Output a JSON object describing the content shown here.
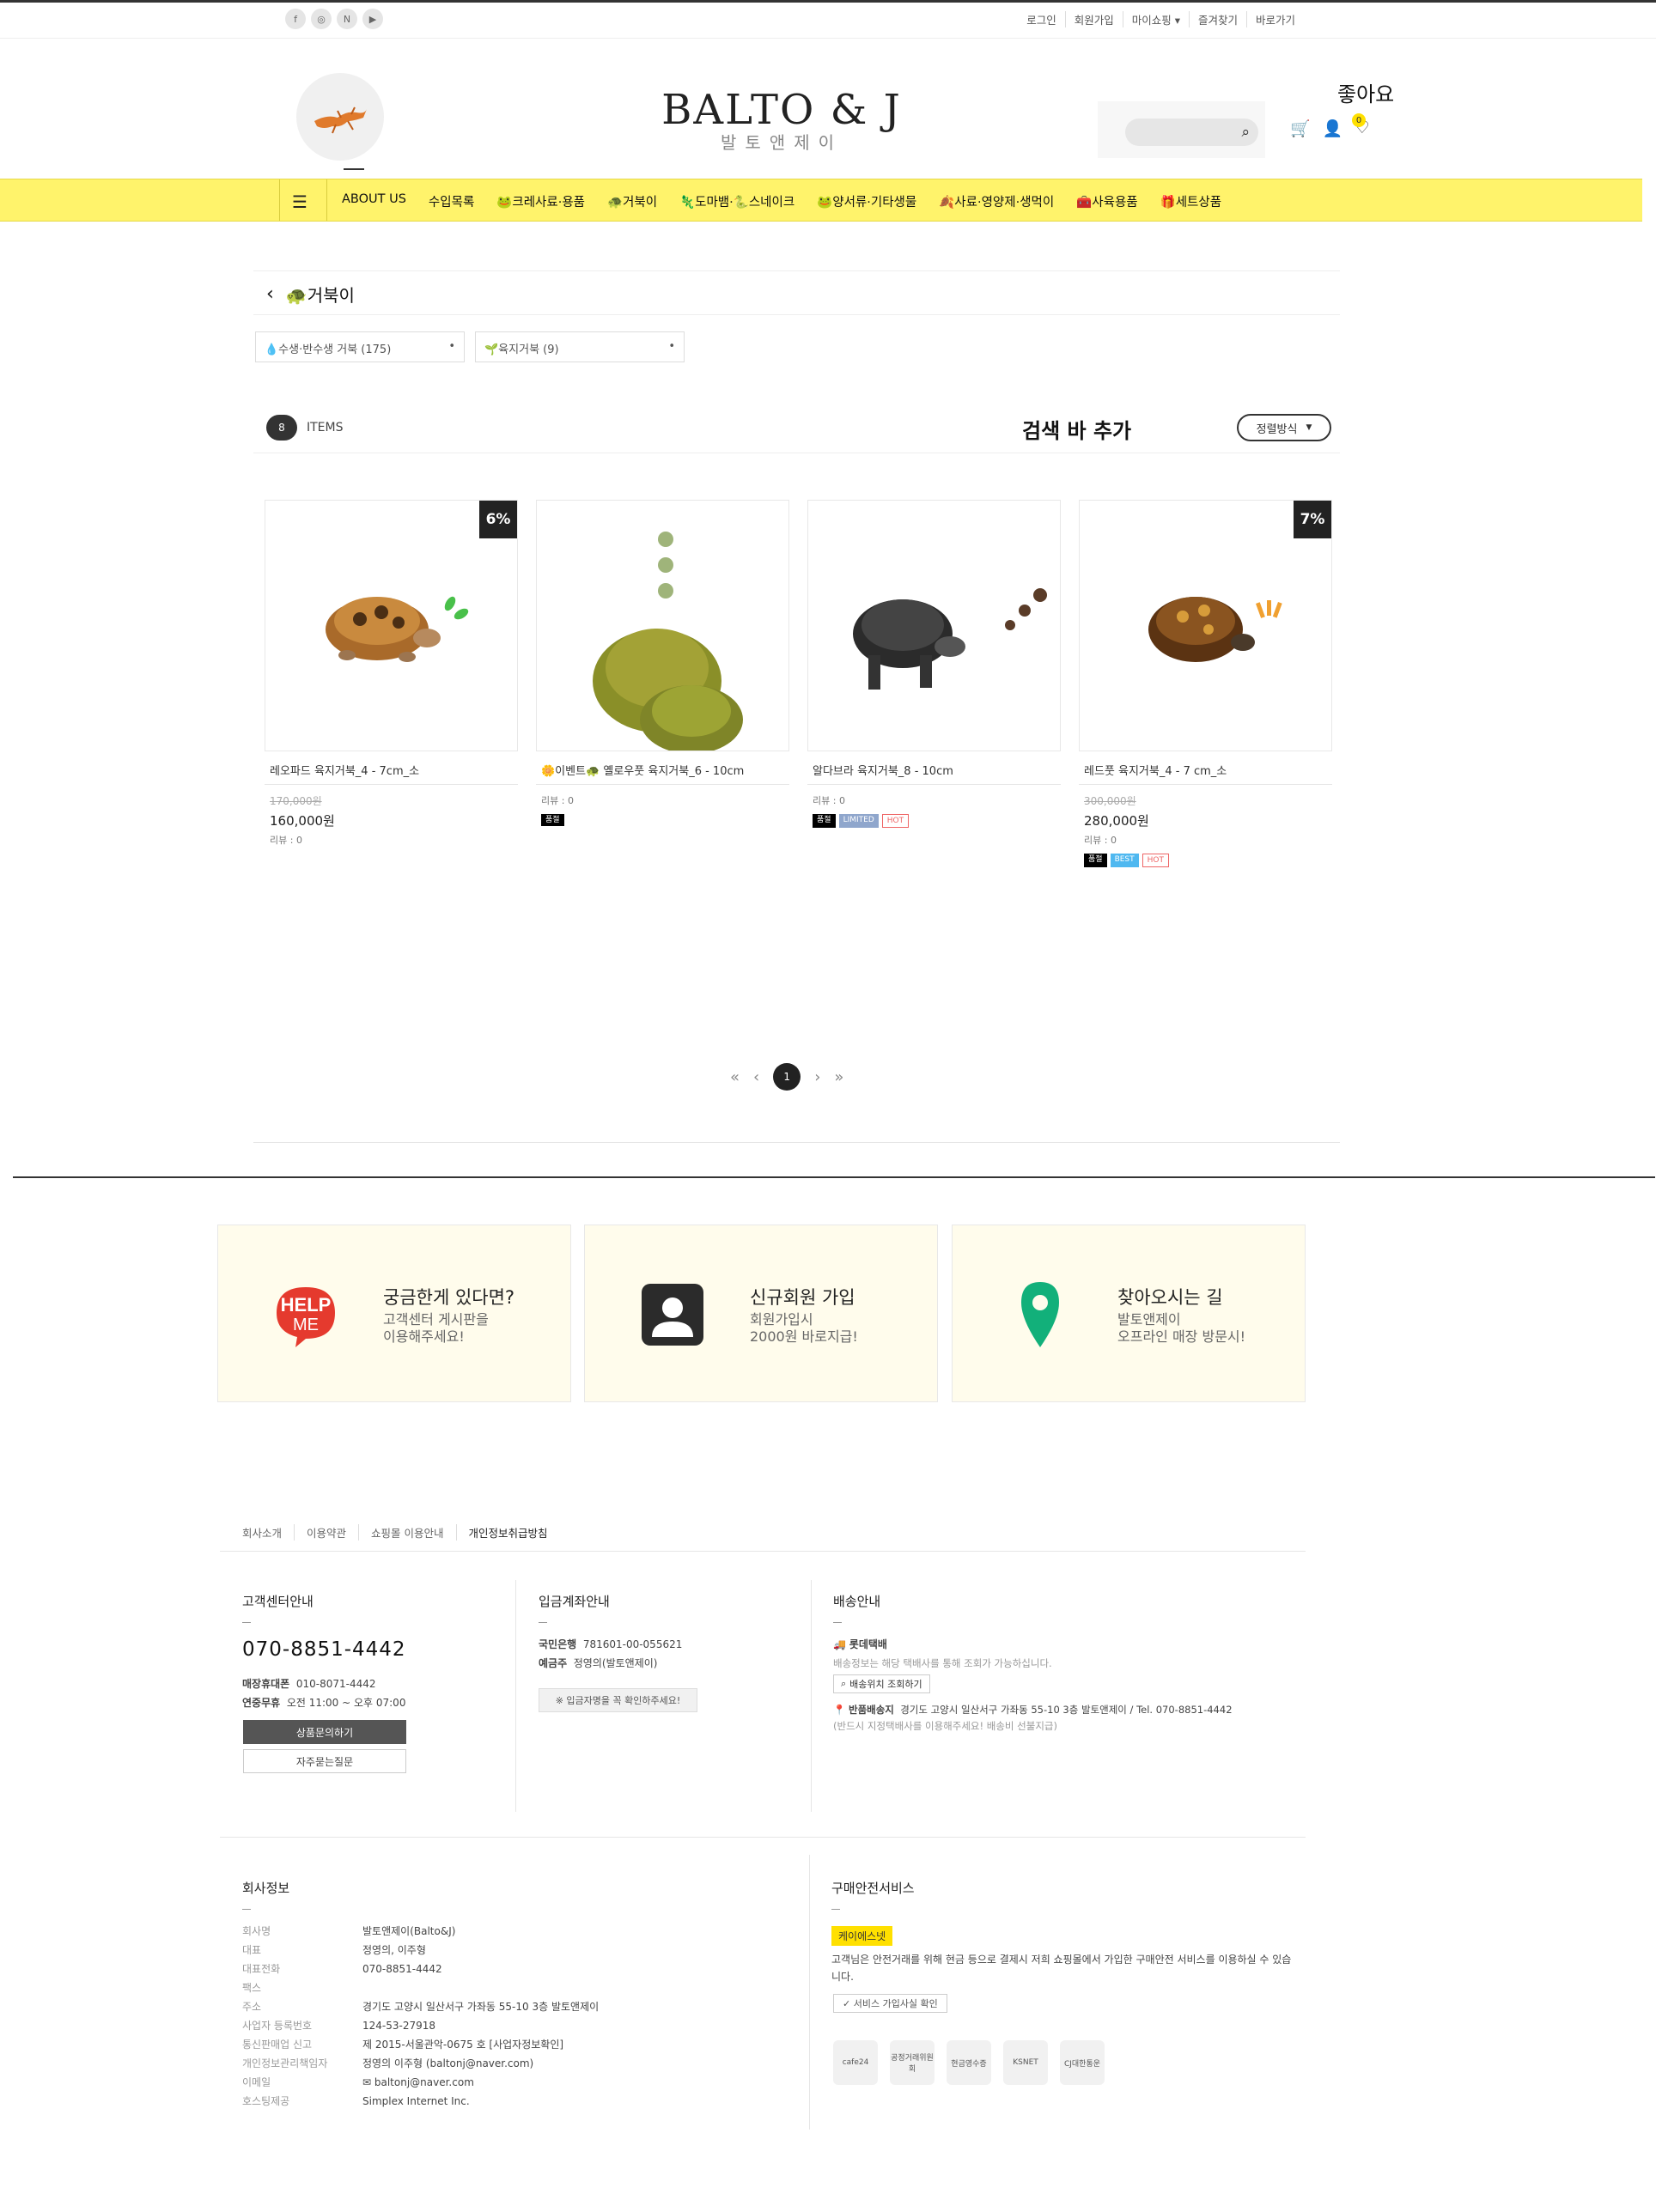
{
  "topbar": {
    "sns": [
      {
        "icon": "facebook-icon",
        "glyph": "f"
      },
      {
        "icon": "instagram-icon",
        "glyph": "◎"
      },
      {
        "icon": "naver-icon",
        "glyph": "N"
      },
      {
        "icon": "youtube-icon",
        "glyph": "▶"
      }
    ],
    "links": [
      "로그인",
      "회원가입",
      "마이쇼핑 ▾",
      "즐겨찾기",
      "바로가기"
    ]
  },
  "header": {
    "logo_main": "BALTO & J",
    "logo_sub": "발토앤제이",
    "like_label": "좋아요",
    "cart_count": "0"
  },
  "nav": {
    "items": [
      "ABOUT US",
      "수입목록",
      "🐸크레사료·용품",
      "🐢거북이",
      "🦎도마뱀·🐍스네이크",
      "🐸양서류·기타생물",
      "🍂사료·영양제·생먹이",
      "🧰사육용품",
      "🎁세트상품"
    ]
  },
  "category": {
    "title": "🐢거북이",
    "subcats": [
      "💧수생·반수생 거북 (175)",
      "🌱육지거북 (9)"
    ],
    "count": "8",
    "items_label": "ITEMS",
    "search_add": "검색 바 추가",
    "sort_label": "정렬방식"
  },
  "products": [
    {
      "name": "레오파드 육지거북_4 - 7cm_소",
      "discount": "6%",
      "old_price": "170,000원",
      "price": "160,000원",
      "review": "리뷰 : 0",
      "tags": []
    },
    {
      "name": "🌼이벤트🐢 옐로우풋 육지거북_6 - 10cm",
      "discount": "",
      "old_price": "",
      "price": "",
      "review": "리뷰 : 0",
      "tags": [
        "품절"
      ]
    },
    {
      "name": "알다브라 육지거북_8 - 10cm",
      "discount": "",
      "old_price": "",
      "price": "",
      "review": "리뷰 : 0",
      "tags": [
        "품절",
        "LIMITED",
        "HOT"
      ]
    },
    {
      "name": "레드풋 육지거북_4 - 7 cm_소",
      "discount": "7%",
      "old_price": "300,000원",
      "price": "280,000원",
      "review": "리뷰 : 0",
      "tags": [
        "품절",
        "BEST",
        "HOT"
      ]
    }
  ],
  "pagination": {
    "current": "1"
  },
  "banners": [
    {
      "icon": "help-me-icon",
      "title": "궁금한게 있다면?",
      "line1": "고객센터 게시판을",
      "line2": "이용해주세요!"
    },
    {
      "icon": "member-icon",
      "title": "신규회원 가입",
      "line1": "회원가입시",
      "line2": "2000원 바로지급!"
    },
    {
      "icon": "map-pin-icon",
      "title": "찾아오시는 길",
      "line1": "발토앤제이",
      "line2": "오프라인 매장 방문시!"
    }
  ],
  "footer": {
    "links": [
      "회사소개",
      "이용약관",
      "쇼핑몰 이용안내",
      "개인정보취급방침"
    ],
    "cs": {
      "title": "고객센터안내",
      "phone": "070-8851-4442",
      "row1_k": "매장휴대폰",
      "row1_v": "010-8071-4442",
      "row2_k": "연중무휴",
      "row2_v": "오전 11:00 ~ 오후 07:00",
      "btn1": "상품문의하기",
      "btn2": "자주묻는질문"
    },
    "bank": {
      "title": "입금계좌안내",
      "row1_k": "국민은행",
      "row1_v": "781601-00-055621",
      "row2_k": "예금주",
      "row2_v": "정영의(발토앤제이)",
      "btn": "※ 입금자명을 꼭 확인하주세요!"
    },
    "delivery": {
      "title": "배송안내",
      "courier": "롯데택배",
      "courier_desc": "배송정보는 해당 택배사를 통해 조회가 가능하십니다.",
      "track_btn": "배송위치 조회하기",
      "return_label": "반품배송지",
      "return_addr": "경기도 고양시 일산서구 가좌동 55-10 3층 발토앤제이 / Tel. 070-8851-4442",
      "return_note": "(반드시 지정택배사를 이용해주세요! 배송비 선불지급)"
    },
    "company": {
      "title": "회사정보",
      "rows": [
        {
          "k": "회사명",
          "v": "발토앤제이(Balto&J)"
        },
        {
          "k": "대표",
          "v": "정영의, 이주형"
        },
        {
          "k": "대표전화",
          "v": "070-8851-4442"
        },
        {
          "k": "팩스",
          "v": ""
        },
        {
          "k": "주소",
          "v": "경기도 고양시 일산서구 가좌동 55-10 3층 발토앤제이"
        },
        {
          "k": "사업자 등록번호",
          "v": "124-53-27918"
        },
        {
          "k": "통신판매업 신고",
          "v": "제 2015-서울관악-0675 호 [사업자정보확인]"
        },
        {
          "k": "개인정보관리책임자",
          "v": "정영의 이주형 (baltonj@naver.com)"
        },
        {
          "k": "이메일",
          "v": "✉ baltonj@naver.com"
        },
        {
          "k": "호스팅제공",
          "v": "Simplex Internet Inc."
        }
      ]
    },
    "safety": {
      "title": "구매안전서비스",
      "badge": "케이에스넷",
      "desc": "고객님은 안전거래를 위해 현금 등으로 결제시 저희 쇼핑몰에서 가입한 구매안전 서비스를 이용하실 수 있습니다.",
      "btn": "서비스 가입사실 확인",
      "logos": [
        "cafe24",
        "공정거래위원회",
        "현금영수증",
        "KSNET",
        "CJ대한통운"
      ]
    }
  },
  "colors": {
    "nav_bg": "#fff36b",
    "banner_bg": "#fffcec",
    "accent_yellow": "#ffe000"
  }
}
